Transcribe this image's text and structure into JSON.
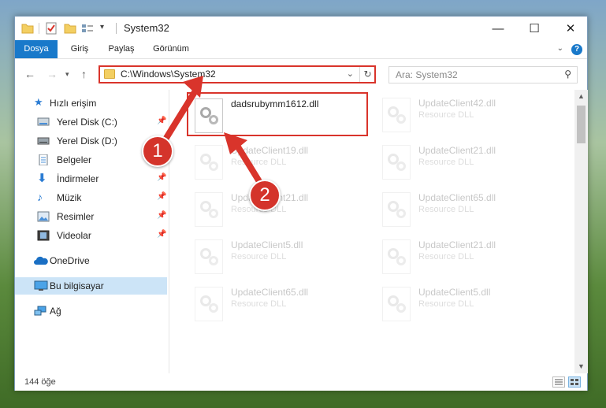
{
  "window": {
    "title": "System32",
    "controls": {
      "minimize": "—",
      "maximize": "☐",
      "close": "✕"
    }
  },
  "ribbon": {
    "tabs": [
      "Dosya",
      "Giriş",
      "Paylaş",
      "Görünüm"
    ],
    "help": "?"
  },
  "address_bar": {
    "path": "C:\\Windows\\System32",
    "search_placeholder": "Ara: System32"
  },
  "nav_pane": {
    "items": [
      {
        "label": "Hızlı erişim",
        "icon": "star-icon",
        "pinned": false
      },
      {
        "label": "Yerel Disk (C:)",
        "icon": "drive-icon",
        "pinned": true
      },
      {
        "label": "Yerel Disk (D:)",
        "icon": "drive-icon",
        "pinned": false
      },
      {
        "label": "Belgeler",
        "icon": "documents-icon",
        "pinned": true
      },
      {
        "label": "İndirmeler",
        "icon": "download-icon",
        "pinned": true
      },
      {
        "label": "Müzik",
        "icon": "music-icon",
        "pinned": true
      },
      {
        "label": "Resimler",
        "icon": "pictures-icon",
        "pinned": true
      },
      {
        "label": "Videolar",
        "icon": "videos-icon",
        "pinned": true
      },
      {
        "label": "OneDrive",
        "icon": "cloud-icon",
        "pinned": false
      },
      {
        "label": "Bu bilgisayar",
        "icon": "computer-icon",
        "pinned": false,
        "selected": true
      },
      {
        "label": "Ağ",
        "icon": "network-icon",
        "pinned": false
      }
    ]
  },
  "files": {
    "left": [
      {
        "name": "dadsrubymm1612.dll",
        "type": "",
        "highlighted": true
      },
      {
        "name": "UpdateClient19.dll",
        "type": "Resource DLL"
      },
      {
        "name": "UpdateClient21.dll",
        "type": "Resource DLL"
      },
      {
        "name": "UpdateClient5.dll",
        "type": "Resource DLL"
      },
      {
        "name": "UpdateClient65.dll",
        "type": "Resource DLL"
      }
    ],
    "right": [
      {
        "name": "UpdateClient42.dll",
        "type": "Resource DLL"
      },
      {
        "name": "UpdateClient21.dll",
        "type": "Resource DLL"
      },
      {
        "name": "UpdateClient65.dll",
        "type": "Resource DLL"
      },
      {
        "name": "UpdateClient21.dll",
        "type": "Resource DLL"
      },
      {
        "name": "UpdateClient5.dll",
        "type": "Resource DLL"
      }
    ]
  },
  "status_bar": {
    "count": "144 öğe"
  },
  "callouts": {
    "one": "1",
    "two": "2"
  },
  "colors": {
    "accent": "#1979ca",
    "highlight": "#d9342b",
    "selected": "#cce4f7"
  }
}
